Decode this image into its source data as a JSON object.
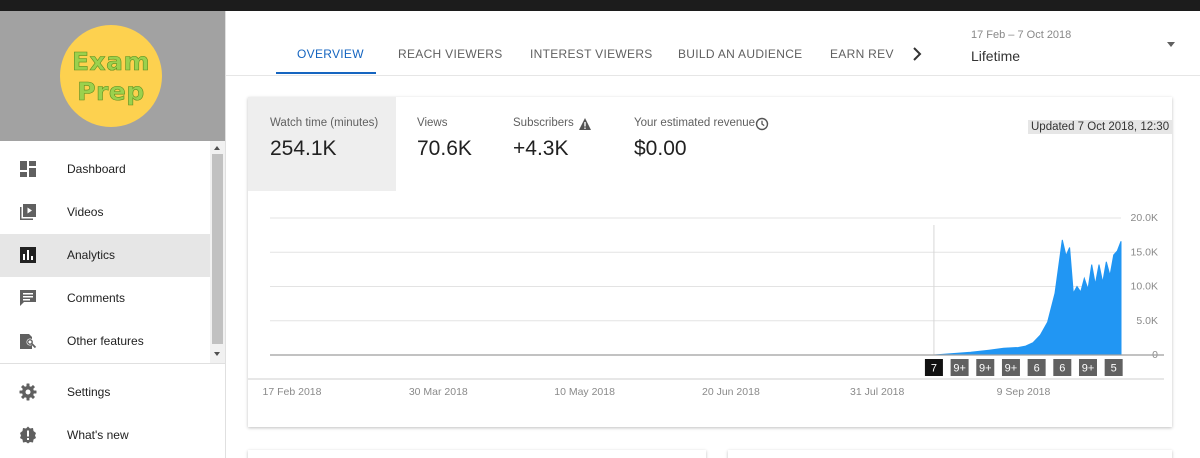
{
  "sidebar": {
    "logo": {
      "line1": "Exam",
      "line2": "Prep"
    },
    "items": [
      {
        "label": "Dashboard",
        "icon": "dashboard-icon"
      },
      {
        "label": "Videos",
        "icon": "video-library-icon"
      },
      {
        "label": "Analytics",
        "icon": "bar-chart-icon",
        "active": true
      },
      {
        "label": "Comments",
        "icon": "comment-icon"
      },
      {
        "label": "Other features",
        "icon": "other-features-icon"
      },
      {
        "label": "Settings",
        "icon": "gear-icon"
      },
      {
        "label": "What's new",
        "icon": "alert-badge-icon"
      }
    ]
  },
  "tabs": [
    {
      "label": "OVERVIEW",
      "active": true
    },
    {
      "label": "REACH VIEWERS"
    },
    {
      "label": "INTEREST VIEWERS"
    },
    {
      "label": "BUILD AN AUDIENCE"
    },
    {
      "label": "EARN REVE"
    }
  ],
  "date_range": {
    "dates": "17 Feb – 7 Oct 2018",
    "label": "Lifetime"
  },
  "metrics": [
    {
      "label": "Watch time (minutes)",
      "value": "254.1K",
      "active": true
    },
    {
      "label": "Views",
      "value": "70.6K"
    },
    {
      "label": "Subscribers",
      "value": "+4.3K",
      "icon": "warning-icon"
    },
    {
      "label": "Your estimated revenue",
      "value": "$0.00",
      "icon": "clock-icon"
    }
  ],
  "updated": "Updated 7 Oct 2018, 12:30",
  "colors": {
    "accent": "#1565c0",
    "chart_fill": "#2196f3",
    "marker_bg": "#616161",
    "marker_active": "#111111"
  },
  "chart_data": {
    "type": "area",
    "y_ticks": [
      "20.0K",
      "15.0K",
      "10.0K",
      "5.0K",
      "0"
    ],
    "ylim": [
      0,
      20000
    ],
    "x_ticks": [
      "17 Feb 2018",
      "30 Mar 2018",
      "10 May 2018",
      "20 Jun 2018",
      "31 Jul 2018",
      "9 Sep 2018"
    ],
    "xlim": [
      "2018-02-17",
      "2018-10-07"
    ],
    "grid": true,
    "divider_date": "2018-08-17",
    "series": [
      {
        "x": [
          "2018-08-17",
          "2018-08-22",
          "2018-08-27",
          "2018-09-01",
          "2018-09-05",
          "2018-09-09",
          "2018-09-11",
          "2018-09-13",
          "2018-09-15",
          "2018-09-17",
          "2018-09-19",
          "2018-09-21",
          "2018-09-22",
          "2018-09-23",
          "2018-09-24",
          "2018-09-25",
          "2018-09-26",
          "2018-09-27",
          "2018-09-28",
          "2018-09-29",
          "2018-09-30",
          "2018-10-01",
          "2018-10-02",
          "2018-10-03",
          "2018-10-04",
          "2018-10-05",
          "2018-10-06",
          "2018-10-07"
        ],
        "values": [
          0,
          200,
          400,
          700,
          1000,
          1100,
          1300,
          1800,
          2900,
          4800,
          9000,
          16800,
          14500,
          15700,
          9000,
          10000,
          9200,
          11200,
          9600,
          13200,
          10300,
          13200,
          10600,
          13600,
          11600,
          14600,
          15200,
          16600
        ]
      }
    ],
    "markers": [
      {
        "label": "7",
        "date": "2018-08-17",
        "active": true
      },
      {
        "label": "9+",
        "date": "2018-08-24"
      },
      {
        "label": "9+",
        "date": "2018-08-31"
      },
      {
        "label": "9+",
        "date": "2018-09-07"
      },
      {
        "label": "6",
        "date": "2018-09-14"
      },
      {
        "label": "6",
        "date": "2018-09-21"
      },
      {
        "label": "9+",
        "date": "2018-09-28"
      },
      {
        "label": "5",
        "date": "2018-10-05"
      }
    ]
  }
}
